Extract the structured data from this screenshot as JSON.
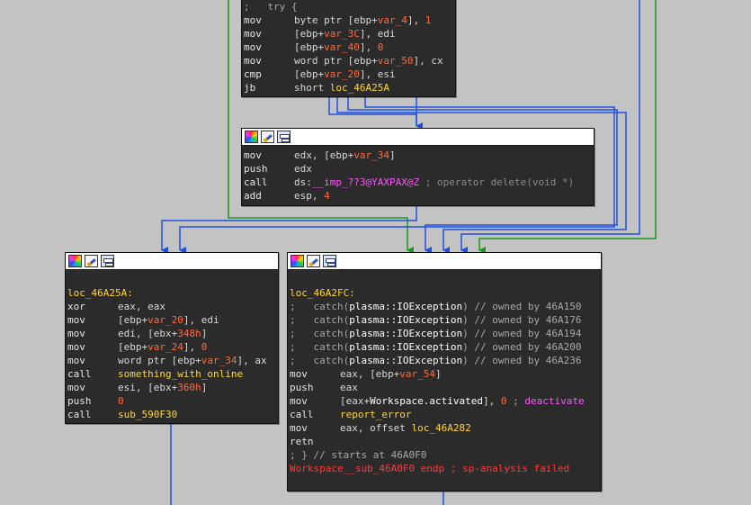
{
  "colors": {
    "background": "#c3c3c3",
    "node_bg": "#2b2b2b",
    "mnemonic": "#e6e6e6",
    "number": "#ff6a3d",
    "label": "#ffd43b",
    "import": "#ff55ff",
    "comment": "#8a8a8a",
    "error": "#ff3b3b",
    "edge_blue": "#2050e0",
    "edge_green": "#1a9a1a"
  },
  "header_icons": [
    "palette-icon",
    "edit-icon",
    "graph-icon"
  ],
  "block_top": {
    "try_comment": ";   try {",
    "lines": [
      {
        "mn": "mov",
        "pre": "byte ptr [ebp+",
        "var": "var_4",
        "mid": "], ",
        "num": "1",
        "post": ""
      },
      {
        "mn": "mov",
        "pre": "[ebp+",
        "var": "var_3C",
        "mid": "], edi",
        "num": "",
        "post": ""
      },
      {
        "mn": "mov",
        "pre": "[ebp+",
        "var": "var_40",
        "mid": "], ",
        "num": "0",
        "post": ""
      },
      {
        "mn": "mov",
        "pre": "word ptr [ebp+",
        "var": "var_50",
        "mid": "], cx",
        "num": "",
        "post": ""
      },
      {
        "mn": "cmp",
        "pre": "[ebp+",
        "var": "var_20",
        "mid": "], esi",
        "num": "",
        "post": ""
      }
    ],
    "jb_mnemonic": "jb",
    "jb_prefix": "short ",
    "jb_target": "loc_46A25A"
  },
  "block_delete": {
    "l1_mn": "mov",
    "l1_pre": "edx, [ebp+",
    "l1_var": "var_34",
    "l1_post": "]",
    "l2_mn": "push",
    "l2_op": "edx",
    "l3_mn": "call",
    "l3_pre": "ds:",
    "l3_imp": "__imp_??3@YAXPAX@Z",
    "l3_cmt": " ; operator delete(void *)",
    "l4_mn": "add",
    "l4_pre": "esp, ",
    "l4_num": "4"
  },
  "block_left": {
    "label": "loc_46A25A:",
    "l1_mn": "xor",
    "l1_op": "eax, eax",
    "l2_mn": "mov",
    "l2_pre": "[ebp+",
    "l2_var": "var_20",
    "l2_post": "], edi",
    "l3_mn": "mov",
    "l3_pre": "edi, [ebx+",
    "l3_num": "348h",
    "l3_post": "]",
    "l4_mn": "mov",
    "l4_pre": "[ebp+",
    "l4_var": "var_24",
    "l4_mid": "], ",
    "l4_num": "0",
    "l5_mn": "mov",
    "l5_pre": "word ptr [ebp+",
    "l5_var": "var_34",
    "l5_post": "], ax",
    "l6_mn": "call",
    "l6_target": "something_with_online",
    "l7_mn": "mov",
    "l7_pre": "esi, [ebx+",
    "l7_num": "360h",
    "l7_post": "]",
    "l8_mn": "push",
    "l8_num": "0",
    "l9_mn": "call",
    "l9_target": "sub_590F30"
  },
  "block_right": {
    "label": "loc_46A2FC:",
    "catches": [
      {
        "pre": ";   catch(",
        "cls": "plasma::IOException",
        "post": ") // owned by 46A150"
      },
      {
        "pre": ";   catch(",
        "cls": "plasma::IOException",
        "post": ") // owned by 46A176"
      },
      {
        "pre": ";   catch(",
        "cls": "plasma::IOException",
        "post": ") // owned by 46A194"
      },
      {
        "pre": ";   catch(",
        "cls": "plasma::IOException",
        "post": ") // owned by 46A200"
      },
      {
        "pre": ";   catch(",
        "cls": "plasma::IOException",
        "post": ") // owned by 46A236"
      }
    ],
    "l1_mn": "mov",
    "l1_pre": "eax, [ebp+",
    "l1_var": "var_54",
    "l1_post": "]",
    "l2_mn": "push",
    "l2_op": "eax",
    "l3_mn": "mov",
    "l3_pre": "[eax+",
    "l3_cls": "Workspace.activated",
    "l3_mid": "], ",
    "l3_num": "0",
    "l3_cmt": " ; ",
    "l3_tail": "deactivate",
    "l4_mn": "call",
    "l4_target": "report_error",
    "l5_mn": "mov",
    "l5_pre": "eax, offset ",
    "l5_target": "loc_46A282",
    "l6_mn": "retn",
    "end_try": "; } // starts at 46A0F0",
    "endp_name": "Workspace__sub_46A0F0",
    "endp_rest": " endp ; sp-analysis failed"
  }
}
